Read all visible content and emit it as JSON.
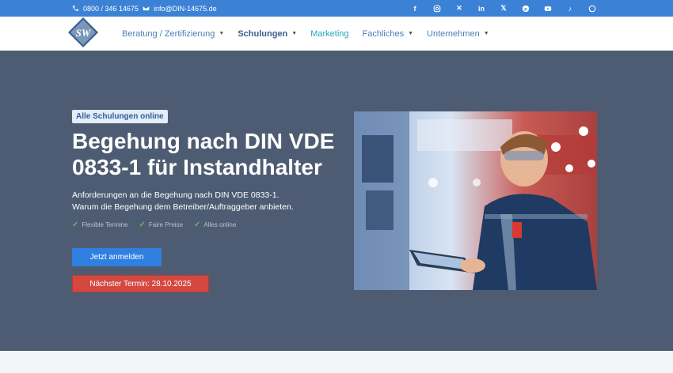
{
  "topbar": {
    "phone": "0800 / 346 14675",
    "email": "info@DIN-14675.de",
    "socials": [
      "facebook-icon",
      "instagram-icon",
      "xing-icon",
      "linkedin-icon",
      "x-twitter-icon",
      "pinterest-icon",
      "youtube-icon",
      "tiktok-icon",
      "whatsapp-icon"
    ]
  },
  "logo": {
    "text": "SW"
  },
  "nav": {
    "items": [
      {
        "label": "Beratung / Zertifizierung"
      },
      {
        "label": "Schulungen"
      },
      {
        "label": "Marketing"
      },
      {
        "label": "Fachliches"
      },
      {
        "label": "Unternehmen"
      }
    ]
  },
  "hero": {
    "badge": "Alle Schulungen online",
    "title": "Begehung nach DIN VDE 0833-1 für Instandhalter",
    "desc_line1": "Anforderungen an die Begehung nach DIN VDE 0833-1.",
    "desc_line2": "Warum die Begehung dem Betreiber/Auftraggeber anbieten.",
    "features": [
      "Flexible Termine",
      "Faire Preise",
      "Alles online"
    ],
    "cta_primary": "Jetzt anmelden",
    "cta_secondary": "Nächster Termin: 28.10.2025"
  },
  "colors": {
    "topbar": "#3b82d6",
    "hero_bg": "#4d5c72",
    "primary_button": "#2f80e0",
    "danger_button": "#d4483f",
    "check": "#5fc15c"
  }
}
